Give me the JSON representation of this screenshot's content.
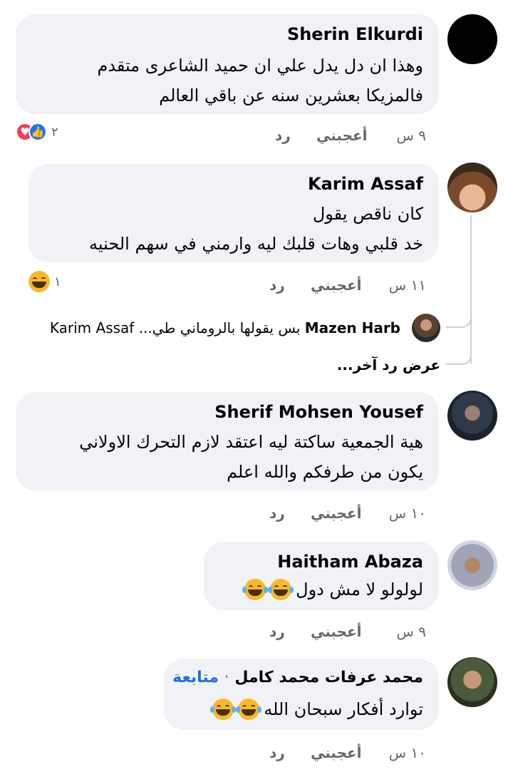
{
  "colors": {
    "bubble": "#f0f2f5",
    "meta": "#65676b",
    "follow_link": "#216fdb",
    "like_blue": "#1877f2",
    "love_red": "#f33e58",
    "haha_yellow": "#f7b928"
  },
  "comments": [
    {
      "author": "Sherin Elkurdi",
      "lines": [
        "وهذا ان دل يدل علي ان حميد الشاعرى متقدم",
        "فالمزيكا بعشرين سنه عن باقي العالم"
      ],
      "time": "٩ س",
      "like": "أعجبني",
      "reply": "رد",
      "reaction_count": "٢",
      "reaction_icons": [
        "like-icon",
        "love-icon"
      ]
    },
    {
      "author": "Karim Assaf",
      "lines": [
        "كان ناقص يقول",
        "خد قلبي وهات قلبك ليه وارمني في سهم الحنيه"
      ],
      "time": "١١ س",
      "like": "أعجبني",
      "reply": "رد",
      "reaction_count": "١",
      "reaction_icons": [
        "haha-icon"
      ],
      "reply_preview": {
        "author": "Mazen Harb",
        "text": "بس يقولها بالروماني طي... Karim Assaf"
      },
      "more_replies": "عرض رد آخر..."
    },
    {
      "author": "Sherif Mohsen Yousef",
      "lines": [
        "هية الجمعية ساكتة ليه اعتقد لازم التحرك الاولاني",
        "يكون من طرفكم والله اعلم"
      ],
      "time": "١٠ س",
      "like": "أعجبني",
      "reply": "رد"
    },
    {
      "author": "Haitham Abaza",
      "lines": [
        "لولولو لا مش دول"
      ],
      "emoji_count": 2,
      "time": "٩ س",
      "like": "أعجبني",
      "reply": "رد"
    },
    {
      "author": "محمد عرفات محمد كامل",
      "follow": "متابعة",
      "separator": "·",
      "lines": [
        "توارد أفكار سبحان الله"
      ],
      "emoji_count": 2,
      "time": "١٠ س",
      "like": "أعجبني",
      "reply": "رد"
    }
  ]
}
